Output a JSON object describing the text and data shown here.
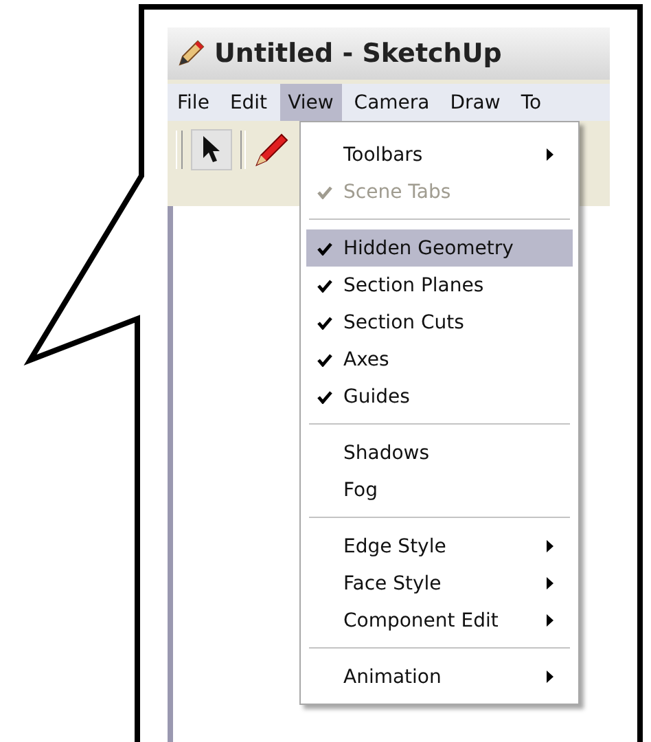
{
  "window": {
    "title": "Untitled - SketchUp"
  },
  "menu_bar": [
    {
      "label": "File",
      "selected": false
    },
    {
      "label": "Edit",
      "selected": false
    },
    {
      "label": "View",
      "selected": true
    },
    {
      "label": "Camera",
      "selected": false
    },
    {
      "label": "Draw",
      "selected": false
    },
    {
      "label": "To",
      "selected": false
    }
  ],
  "menu": [
    {
      "kind": "item",
      "label": "Toolbars",
      "checked": false,
      "disabled": false,
      "selected": false,
      "submenu": true
    },
    {
      "kind": "item",
      "label": "Scene Tabs",
      "checked": true,
      "disabled": true,
      "selected": false,
      "submenu": false
    },
    {
      "kind": "separator"
    },
    {
      "kind": "item",
      "label": "Hidden Geometry",
      "checked": true,
      "disabled": false,
      "selected": true,
      "submenu": false
    },
    {
      "kind": "item",
      "label": "Section Planes",
      "checked": true,
      "disabled": false,
      "selected": false,
      "submenu": false
    },
    {
      "kind": "item",
      "label": "Section Cuts",
      "checked": true,
      "disabled": false,
      "selected": false,
      "submenu": false
    },
    {
      "kind": "item",
      "label": "Axes",
      "checked": true,
      "disabled": false,
      "selected": false,
      "submenu": false
    },
    {
      "kind": "item",
      "label": "Guides",
      "checked": true,
      "disabled": false,
      "selected": false,
      "submenu": false
    },
    {
      "kind": "separator"
    },
    {
      "kind": "item",
      "label": "Shadows",
      "checked": false,
      "disabled": false,
      "selected": false,
      "submenu": false
    },
    {
      "kind": "item",
      "label": "Fog",
      "checked": false,
      "disabled": false,
      "selected": false,
      "submenu": false
    },
    {
      "kind": "separator"
    },
    {
      "kind": "item",
      "label": "Edge Style",
      "checked": false,
      "disabled": false,
      "selected": false,
      "submenu": true
    },
    {
      "kind": "item",
      "label": "Face Style",
      "checked": false,
      "disabled": false,
      "selected": false,
      "submenu": true
    },
    {
      "kind": "item",
      "label": "Component Edit",
      "checked": false,
      "disabled": false,
      "selected": false,
      "submenu": true
    },
    {
      "kind": "separator"
    },
    {
      "kind": "item",
      "label": "Animation",
      "checked": false,
      "disabled": false,
      "selected": false,
      "submenu": true
    }
  ]
}
